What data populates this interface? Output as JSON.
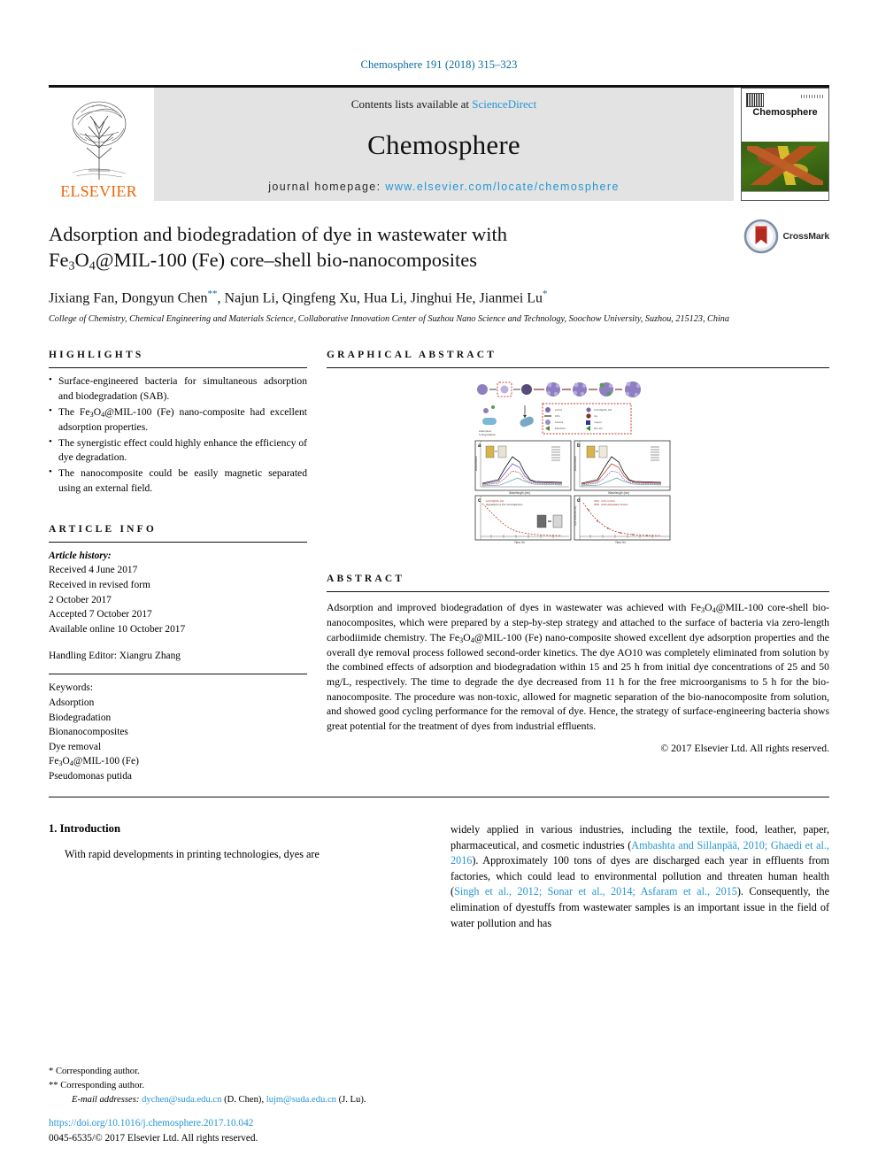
{
  "running_head": "Chemosphere 191 (2018) 315–323",
  "masthead": {
    "publisher_name": "ELSEVIER",
    "contents_prefix": "Contents lists available at ",
    "contents_link": "ScienceDirect",
    "journal_name": "Chemosphere",
    "homepage_prefix": "journal homepage: ",
    "homepage_url": "www.elsevier.com/locate/chemosphere",
    "cover_title": "Chemosphere"
  },
  "article": {
    "title_line1": "Adsorption and biodegradation of dye in wastewater with",
    "title_line2_a": "Fe",
    "title_line2_sub1": "3",
    "title_line2_b": "O",
    "title_line2_sub2": "4",
    "title_line2_c": "@MIL-100 (Fe) core–shell bio-nanocomposites",
    "authors": "Jixiang Fan, Dongyun Chen**, Najun Li, Qingfeng Xu, Hua Li, Jinghui He, Jianmei Lu*",
    "affiliation": "College of Chemistry, Chemical Engineering and Materials Science, Collaborative Innovation Center of Suzhou Nano Science and Technology, Soochow University, Suzhou, 215123, China",
    "crossmark_label": "CrossMark"
  },
  "sections": {
    "highlights_heading": "HIGHLIGHTS",
    "graphical_abstract_heading": "GRAPHICAL ABSTRACT",
    "article_info_heading": "ARTICLE INFO",
    "abstract_heading": "ABSTRACT"
  },
  "highlights": [
    "Surface-engineered bacteria for simultaneous adsorption and biodegradation (SAB).",
    "The Fe3O4@MIL-100 (Fe) nano-composite had excellent adsorption properties.",
    "The synergistic effect could highly enhance the efficiency of dye degradation.",
    "The nanocomposite could be easily magnetic separated using an external field."
  ],
  "article_info": {
    "history_label": "Article history:",
    "history": [
      "Received 4 June 2017",
      "Received in revised form",
      "2 October 2017",
      "Accepted 7 October 2017",
      "Available online 10 October 2017"
    ],
    "handling_editor": "Handling Editor: Xiangru Zhang",
    "keywords_label": "Keywords:",
    "keywords": [
      "Adsorption",
      "Biodegradation",
      "Bionanocomposites",
      "Dye removal",
      "Fe3O4@MIL-100 (Fe)",
      "Pseudomonas putida"
    ]
  },
  "abstract": {
    "text": "Adsorption and improved biodegradation of dyes in wastewater was achieved with Fe3O4@MIL-100 core-shell bio-nanocomposites, which were prepared by a step-by-step strategy and attached to the surface of bacteria via zero-length carbodiimide chemistry. The Fe3O4@MIL-100 (Fe) nano-composite showed excellent dye adsorption properties and the overall dye removal process followed second-order kinetics. The dye AO10 was completely eliminated from solution by the combined effects of adsorption and biodegradation within 15 and 25 h from initial dye concentrations of 25 and 50 mg/L, respectively. The time to degrade the dye decreased from 11 h for the free microorganisms to 5 h for the bio-nanocomposite. The procedure was non-toxic, allowed for magnetic separation of the bio-nanocomposite from solution, and showed good cycling performance for the removal of dye. Hence, the strategy of surface-engineering bacteria shows great potential for the treatment of dyes from industrial effluents.",
    "copyright": "© 2017 Elsevier Ltd. All rights reserved."
  },
  "body": {
    "section_number_title": "1. Introduction",
    "left_paragraph": "With rapid developments in printing technologies, dyes are",
    "right_paragraph_parts": [
      {
        "t": "widely applied in various industries, including the textile, food, leather, paper, pharmaceutical, and cosmetic industries (",
        "link": false
      },
      {
        "t": "Ambashta and Sillanpää, 2010; Ghaedi et al., 2016",
        "link": true
      },
      {
        "t": "). Approximately 100 tons of dyes are discharged each year in effluents from factories, which could lead to environmental pollution and threaten human health (",
        "link": false
      },
      {
        "t": "Singh et al., 2012; Sonar et al., 2014; Asfaram et al., 2015",
        "link": true
      },
      {
        "t": "). Consequently, the elimination of dyestuffs from wastewater samples is an important issue in the field of water pollution and has",
        "link": false
      }
    ]
  },
  "footnotes": {
    "corresponding_1": "* Corresponding author.",
    "corresponding_2": "** Corresponding author.",
    "emails_label": "E-mail addresses:",
    "email_1": "dychen@suda.edu.cn",
    "email_1_who": "(D. Chen),",
    "email_2": "lujm@suda.edu.cn",
    "email_2_who": "(J. Lu).",
    "doi": "https://doi.org/10.1016/j.chemosphere.2017.10.042",
    "issn_line": "0045-6535/© 2017 Elsevier Ltd. All rights reserved."
  },
  "colors": {
    "link_blue": "#2596d1",
    "head_blue": "#0a6ba1",
    "elsevier_orange": "#ec6707",
    "masthead_grey": "#e3e3e3"
  }
}
